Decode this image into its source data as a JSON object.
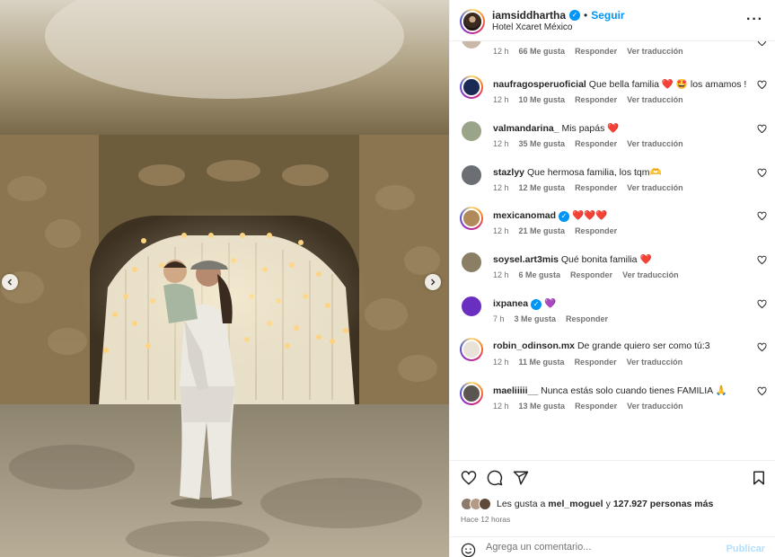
{
  "post": {
    "username": "iamsiddhartha",
    "follow_label": "Seguir",
    "separator": "•",
    "location": "Hotel Xcaret México",
    "more_label": "···"
  },
  "comments": [
    {
      "user": "",
      "text": "",
      "time": "12 h",
      "likes": "66 Me gusta",
      "reply": "Responder",
      "translate": "Ver traducción",
      "verified": false,
      "avatar": "#c9b8a8"
    },
    {
      "user": "naufragosperuoficial",
      "text": "Que bella familia ❤️ 🤩 los amamos !",
      "time": "12 h",
      "likes": "10 Me gusta",
      "reply": "Responder",
      "translate": "Ver traducción",
      "verified": false,
      "avatar": "#1b2a55"
    },
    {
      "user": "valmandarina_",
      "text": "Mis papás ❤️",
      "time": "12 h",
      "likes": "35 Me gusta",
      "reply": "Responder",
      "translate": "Ver traducción",
      "verified": false,
      "avatar": "#9aa489"
    },
    {
      "user": "stazlyy",
      "text": "Que hermosa familia, los tqm🫶",
      "time": "12 h",
      "likes": "12 Me gusta",
      "reply": "Responder",
      "translate": "Ver traducción",
      "verified": false,
      "avatar": "#6b6e72"
    },
    {
      "user": "mexicanomad",
      "text": "❤️❤️❤️",
      "time": "12 h",
      "likes": "21 Me gusta",
      "reply": "Responder",
      "translate": "",
      "verified": true,
      "avatar": "#b08a5a"
    },
    {
      "user": "soysel.art3mis",
      "text": "Qué bonita familia ❤️",
      "time": "12 h",
      "likes": "6 Me gusta",
      "reply": "Responder",
      "translate": "Ver traducción",
      "verified": false,
      "avatar": "#8a7f64"
    },
    {
      "user": "ixpanea",
      "text": "💜",
      "time": "7 h",
      "likes": "3 Me gusta",
      "reply": "Responder",
      "translate": "",
      "verified": true,
      "avatar": "#6a2fc0"
    },
    {
      "user": "robin_odinson.mx",
      "text": "De grande quiero ser como tú:3",
      "time": "12 h",
      "likes": "11 Me gusta",
      "reply": "Responder",
      "translate": "Ver traducción",
      "verified": false,
      "avatar": "#e8e2d8"
    },
    {
      "user": "maeliiiii__",
      "text": "Nunca estás solo cuando tienes FAMILIA 🙏",
      "time": "12 h",
      "likes": "13 Me gusta",
      "reply": "Responder",
      "translate": "Ver traducción",
      "verified": false,
      "avatar": "#5a5550"
    }
  ],
  "likes": {
    "prefix": "Les gusta a",
    "user": "mel_moguel",
    "joiner": "y",
    "count": "127.927 personas más"
  },
  "timestamp": "Hace 12 horas",
  "comment_box": {
    "placeholder": "Agrega un comentario...",
    "publish_label": "Publicar"
  },
  "colors": {
    "accent": "#0095f6",
    "heart": "#ed4956",
    "muted": "#737373",
    "publish_disabled": "#b2dffc"
  },
  "icons": [
    "verified-badge-icon",
    "more-options-icon",
    "like-icon",
    "comment-icon",
    "share-icon",
    "save-icon",
    "emoji-icon",
    "load-more-icon",
    "carousel-prev-icon",
    "carousel-next-icon"
  ]
}
